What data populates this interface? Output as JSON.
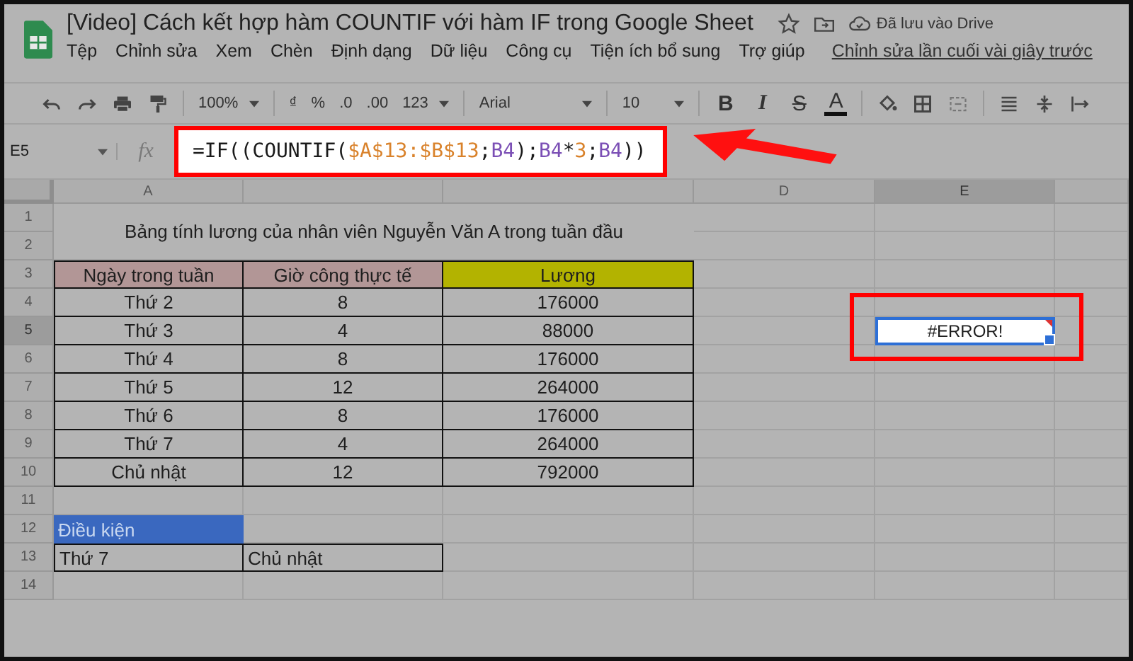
{
  "document": {
    "title": "[Video] Cách kết hợp hàm COUNTIF với hàm IF trong Google Sheet",
    "saved_status": "Đã lưu vào Drive"
  },
  "menu": [
    "Tệp",
    "Chỉnh sửa",
    "Xem",
    "Chèn",
    "Định dạng",
    "Dữ liệu",
    "Công cụ",
    "Tiện ích bổ sung",
    "Trợ giúp"
  ],
  "last_edit": "Chỉnh sửa lần cuối vài giây trước",
  "toolbar": {
    "zoom": "100%",
    "currency": "₫",
    "percent": "%",
    "decimal_less": ".0",
    "decimal_more": ".00",
    "number_format": "123",
    "font": "Arial",
    "font_size": "10",
    "text_styles": [
      "B",
      "I",
      "S",
      "A"
    ]
  },
  "formula_bar": {
    "name_box": "E5",
    "function_label": "fx",
    "formula": [
      {
        "text": "=IF((COUNTIF(",
        "color": "#1a1a1a"
      },
      {
        "text": "$A$13:$B$13",
        "color": "#d9822b"
      },
      {
        "text": ";",
        "color": "#1a1a1a"
      },
      {
        "text": "B4",
        "color": "#7b4fb5"
      },
      {
        "text": ");",
        "color": "#1a1a1a"
      },
      {
        "text": "B4",
        "color": "#7b4fb5"
      },
      {
        "text": "*",
        "color": "#1a1a1a"
      },
      {
        "text": "3",
        "color": "#d9822b"
      },
      {
        "text": ";",
        "color": "#1a1a1a"
      },
      {
        "text": "B4",
        "color": "#7b4fb5"
      },
      {
        "text": "))",
        "color": "#1a1a1a"
      }
    ]
  },
  "columns": [
    {
      "label": "A",
      "selected": false
    },
    {
      "label": "D",
      "selected": false
    },
    {
      "label": "E",
      "selected": true
    }
  ],
  "rows": [
    {
      "label": "1",
      "selected": false
    },
    {
      "label": "2",
      "selected": false
    },
    {
      "label": "3",
      "selected": false
    },
    {
      "label": "4",
      "selected": false
    },
    {
      "label": "5",
      "selected": true
    },
    {
      "label": "6",
      "selected": false
    },
    {
      "label": "7",
      "selected": false
    },
    {
      "label": "8",
      "selected": false
    },
    {
      "label": "9",
      "selected": false
    },
    {
      "label": "10",
      "selected": false
    },
    {
      "label": "11",
      "selected": false
    },
    {
      "label": "12",
      "selected": false
    },
    {
      "label": "13",
      "selected": false
    },
    {
      "label": "14",
      "selected": false
    }
  ],
  "sheet": {
    "title": "Bảng tính lương của nhân viên Nguyễn Văn A trong tuần đầu",
    "headers": [
      {
        "text": "Ngày trong tuần",
        "color": "#b29696"
      },
      {
        "text": "Giờ công thực tế",
        "color": "#b29696"
      },
      {
        "text": "Lương",
        "color": "#b3b300"
      }
    ],
    "data": [
      [
        "Thứ 2",
        "8",
        "176000"
      ],
      [
        "Thứ 3",
        "4",
        "88000"
      ],
      [
        "Thứ 4",
        "8",
        "176000"
      ],
      [
        "Thứ 5",
        "12",
        "264000"
      ],
      [
        "Thứ 6",
        "8",
        "176000"
      ],
      [
        "Thứ 7",
        "4",
        "264000"
      ],
      [
        "Chủ nhật",
        "12",
        "792000"
      ]
    ],
    "condition_label": "Điều kiện",
    "conditions": [
      "Thứ 7",
      "Chủ nhật"
    ],
    "active_cell": "#ERROR!"
  }
}
